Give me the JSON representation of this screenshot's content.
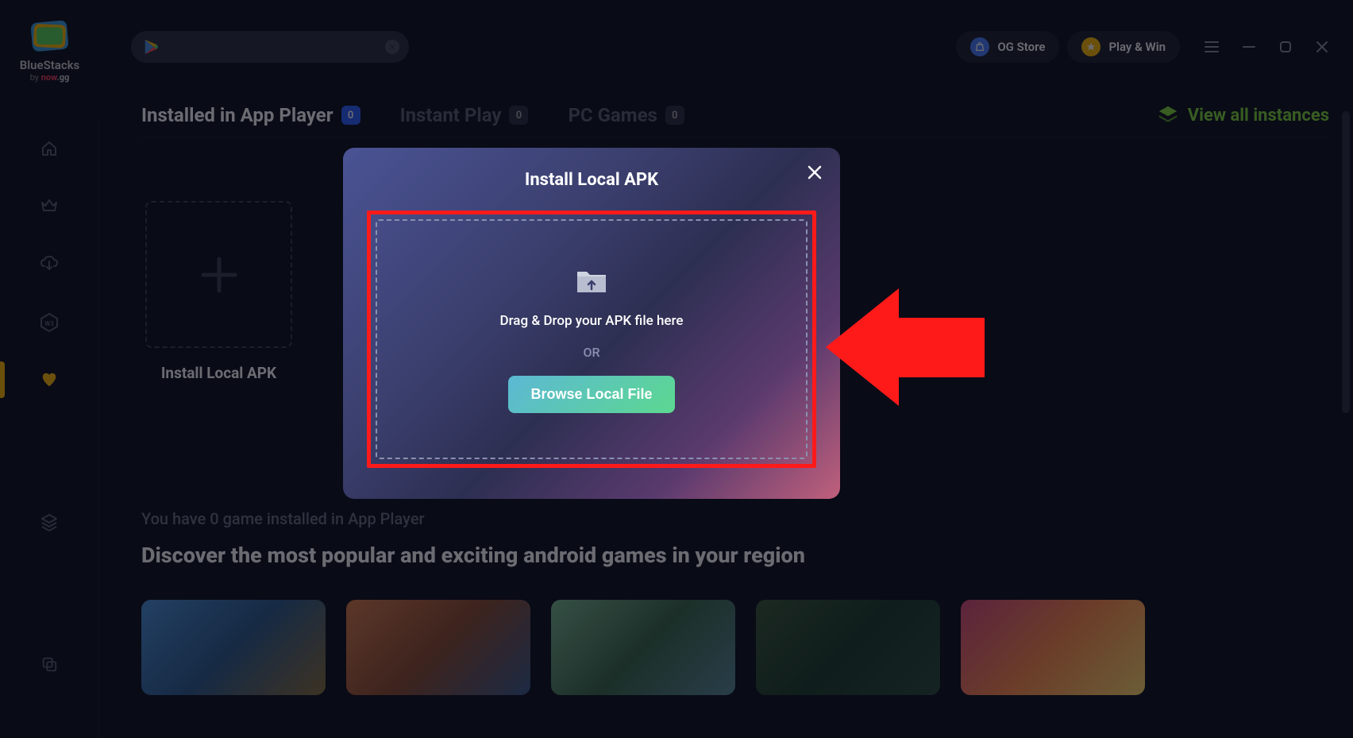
{
  "logo": {
    "name": "BlueStacks",
    "byLabel": "by",
    "byBrand1": "now",
    "byBrand2": ".gg"
  },
  "topbar": {
    "ogStore": "OG Store",
    "playWin": "Play & Win"
  },
  "tabs": {
    "installed": {
      "label": "Installed in App Player",
      "count": "0"
    },
    "instant": {
      "label": "Instant Play",
      "count": "0"
    },
    "pc": {
      "label": "PC Games",
      "count": "0"
    }
  },
  "viewInstances": "View all instances",
  "installCard": {
    "label": "Install Local APK"
  },
  "infoText": "You have 0 game installed in App Player",
  "discoverHeading": "Discover the most popular and exciting android games in your region",
  "modal": {
    "title": "Install Local APK",
    "dropText": "Drag & Drop your APK file here",
    "orText": "OR",
    "browseLabel": "Browse Local File"
  }
}
